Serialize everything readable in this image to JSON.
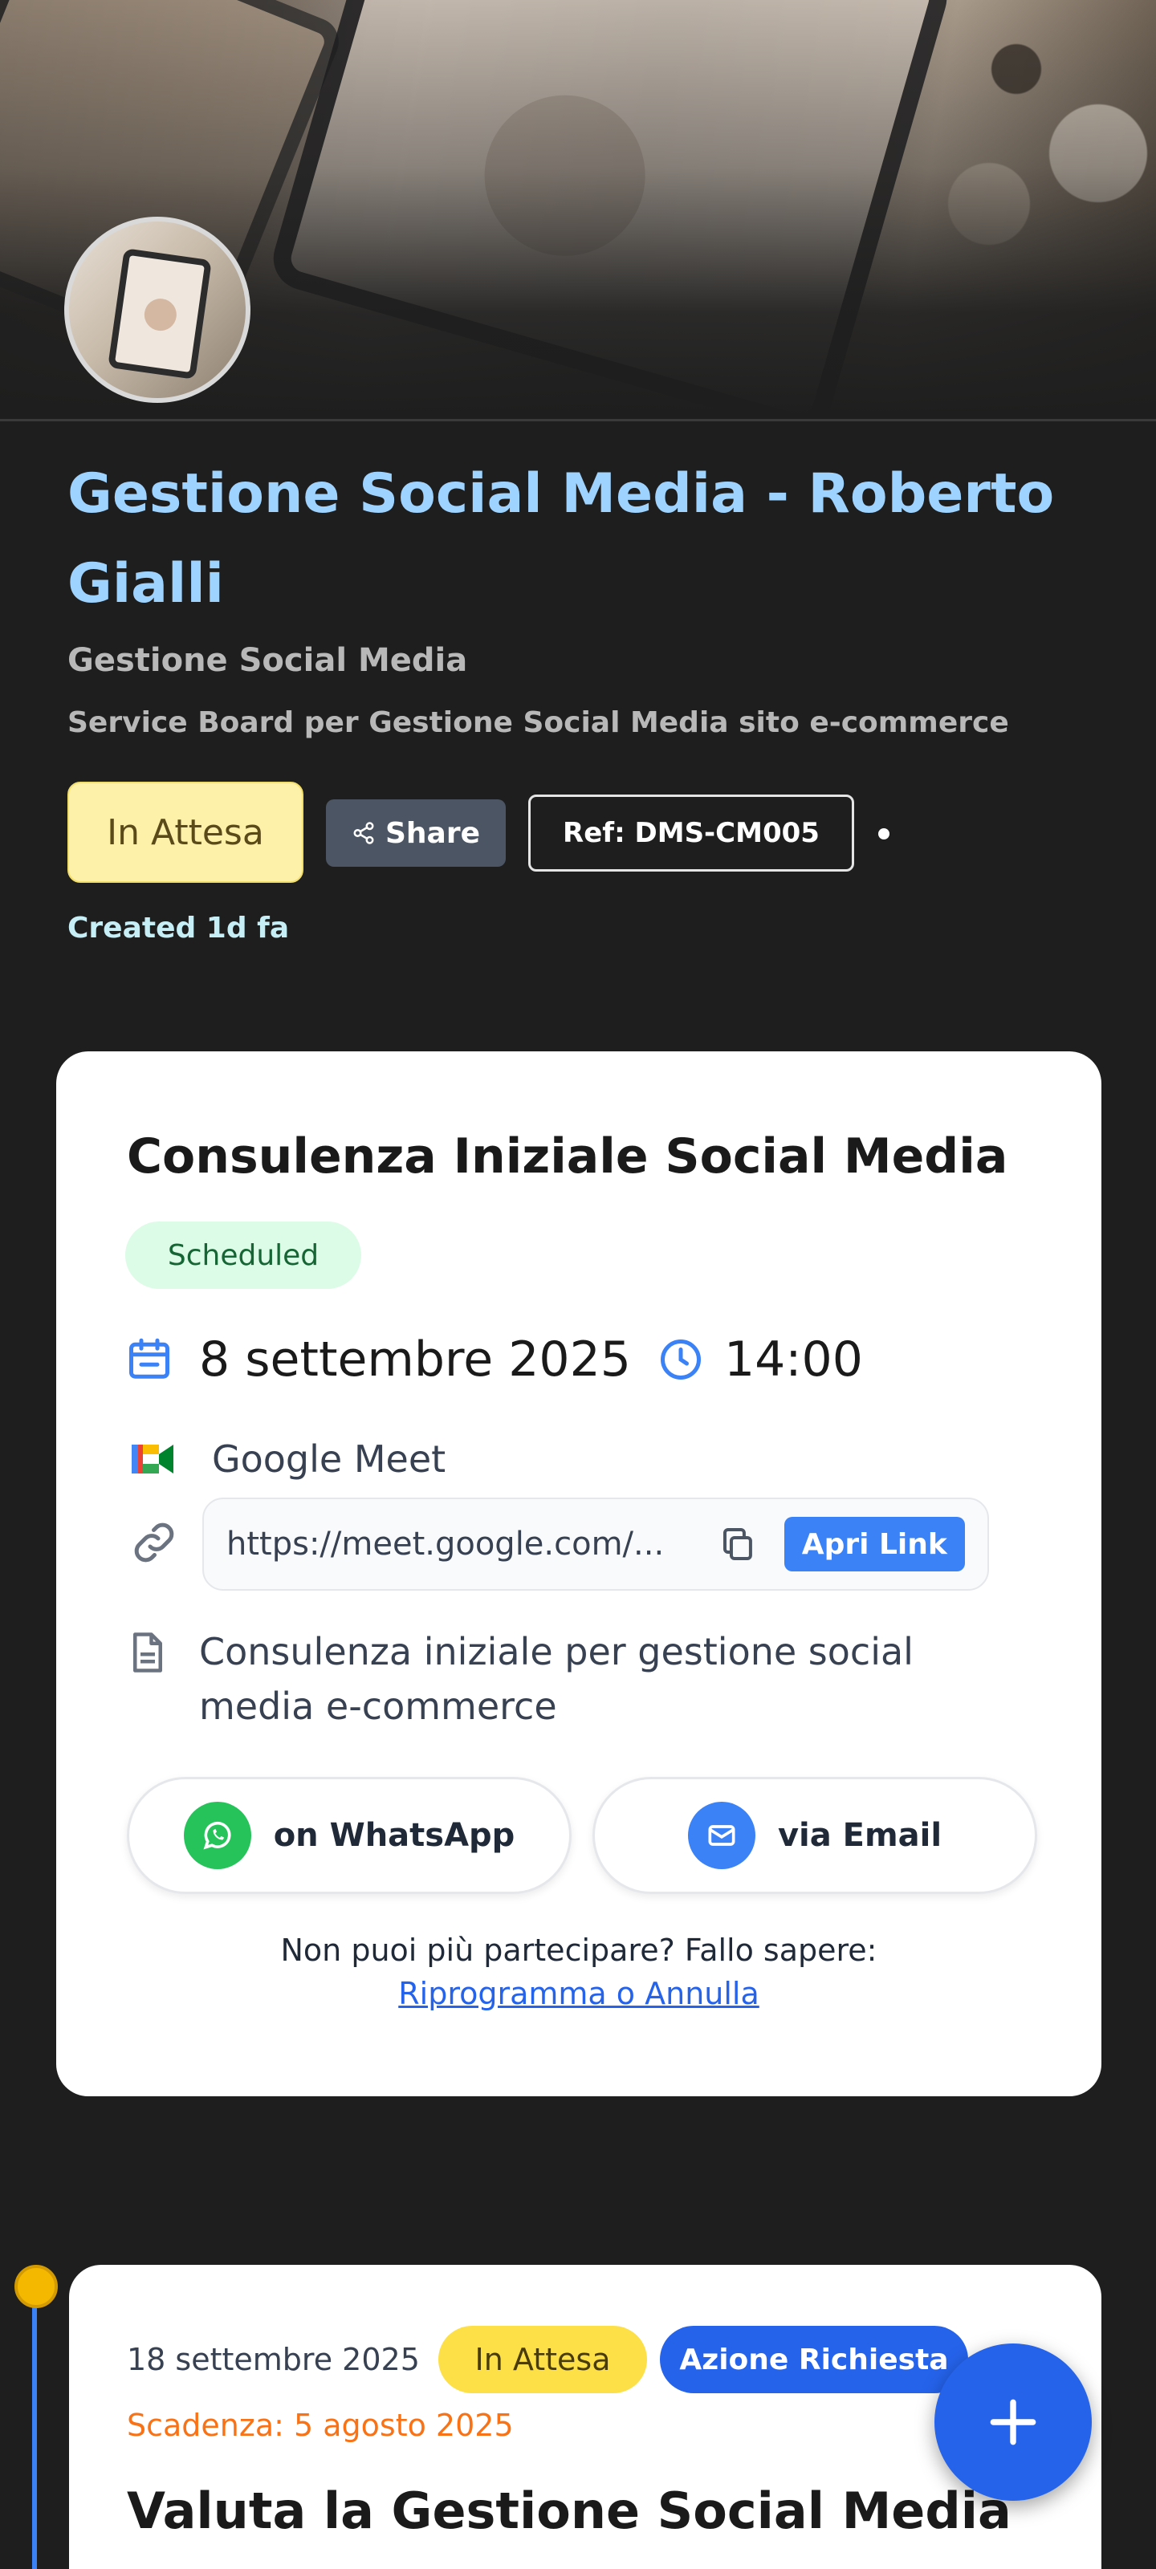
{
  "header": {
    "title": "Gestione Social Media - Roberto Gialli",
    "subtitle": "Gestione Social Media",
    "description": "Service Board per Gestione Social Media sito e-commerce",
    "status": "In Attesa",
    "share_label": "Share",
    "ref_label": "Ref: DMS-CM005",
    "created": "Created 1d fa"
  },
  "meeting_card": {
    "title": "Consulenza Iniziale Social Media",
    "status_badge": "Scheduled",
    "date": "8 settembre 2025",
    "time": "14:00",
    "platform": "Google Meet",
    "link_url": "https://meet.google.com/...",
    "open_link_label": "Apri Link",
    "note": "Consulenza iniziale per gestione social media e-commerce",
    "whatsapp_label": "on WhatsApp",
    "email_label": "via Email",
    "cant_attend_text": "Non puoi più partecipare? Fallo sapere:",
    "reschedule_label": "Riprogramma o Annulla"
  },
  "timeline_card": {
    "date": "18 settembre 2025",
    "status_badge": "In Attesa",
    "action_badge": "Azione Richiesta",
    "deadline": "Scadenza: 5 agosto 2025",
    "title": "Valuta la Gestione Social Media"
  },
  "colors": {
    "background": "#1e1e1e",
    "title_blue": "#9fd3ff",
    "status_yellow": "#fdf0a8",
    "accent_blue": "#2563eb",
    "scheduled_green": "#dcfce7",
    "whatsapp_green": "#25c35a",
    "deadline_orange": "#f97316"
  },
  "icons": {
    "calendar": "calendar-icon",
    "clock": "clock-icon",
    "meet": "google-meet-icon",
    "link": "link-icon",
    "copy": "copy-icon",
    "note": "document-icon",
    "whatsapp": "whatsapp-icon",
    "email": "email-icon",
    "share": "share-icon",
    "fab": "plus-icon"
  }
}
